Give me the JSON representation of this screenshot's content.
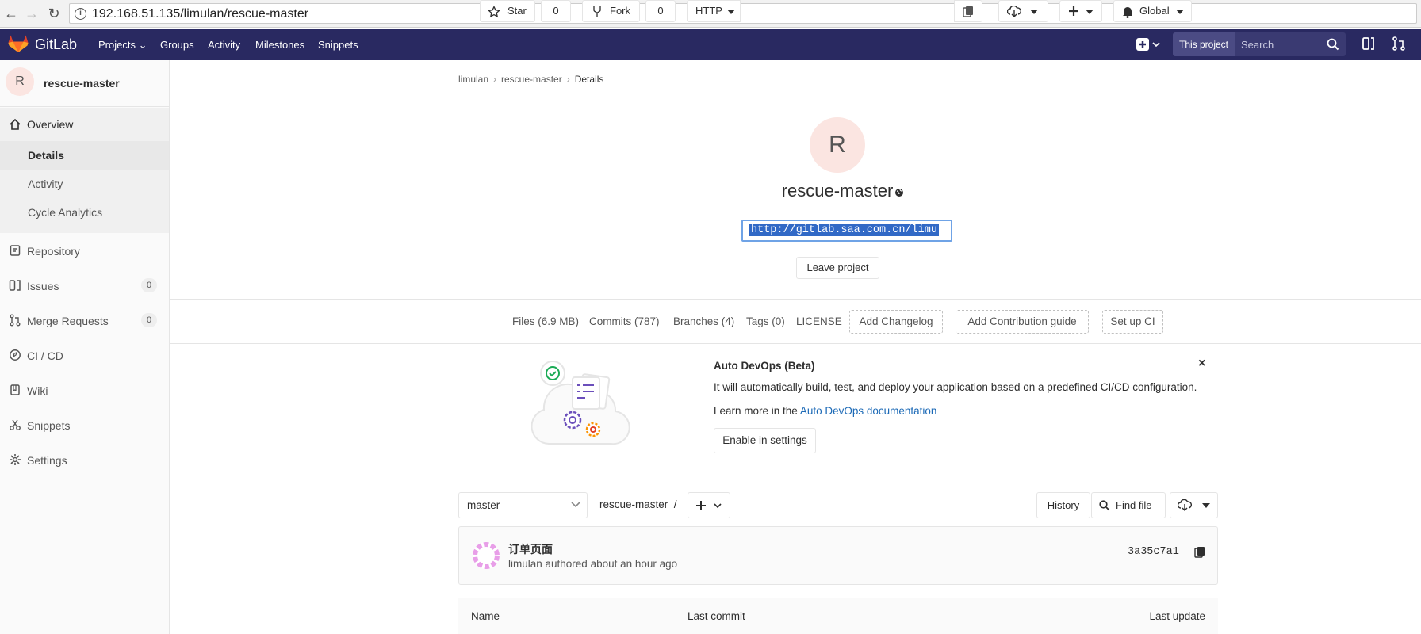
{
  "browser": {
    "url": "192.168.51.135/limulan/rescue-master"
  },
  "header": {
    "brand": "GitLab",
    "nav": [
      "Projects",
      "Groups",
      "Activity",
      "Milestones",
      "Snippets"
    ],
    "scope_label": "This project",
    "search_placeholder": "Search",
    "brand_color": "#292961"
  },
  "sidebar": {
    "project_initial": "R",
    "project_name": "rescue-master",
    "overview_label": "Overview",
    "overview_items": [
      "Details",
      "Activity",
      "Cycle Analytics"
    ],
    "items": [
      {
        "label": "Repository",
        "icon": "repository-icon"
      },
      {
        "label": "Issues",
        "count": "0",
        "icon": "issues-icon"
      },
      {
        "label": "Merge Requests",
        "count": "0",
        "icon": "merge-request-icon"
      },
      {
        "label": "CI / CD",
        "icon": "rocket-icon"
      },
      {
        "label": "Wiki",
        "icon": "book-icon"
      },
      {
        "label": "Snippets",
        "icon": "scissors-icon"
      },
      {
        "label": "Settings",
        "icon": "gear-icon"
      }
    ]
  },
  "breadcrumb": [
    "limulan",
    "rescue-master",
    "Details"
  ],
  "project": {
    "initial": "R",
    "name": "rescue-master",
    "star_label": "Star",
    "star_count": "0",
    "fork_label": "Fork",
    "fork_count": "0",
    "protocol": "HTTP",
    "clone_url": "http://gitlab.saa.com.cn/limu",
    "notification_label": "Global",
    "leave_label": "Leave project"
  },
  "stats": {
    "files": "Files (6.9 MB)",
    "commits": "Commits (787)",
    "branches": "Branches (4)",
    "tags": "Tags (0)",
    "license": "LICENSE",
    "add_changelog": "Add Changelog",
    "add_contribution": "Add Contribution guide",
    "setup_ci": "Set up CI"
  },
  "devops": {
    "title": "Auto DevOps (Beta)",
    "text": "It will automatically build, test, and deploy your application based on a predefined CI/CD configuration.",
    "more_prefix": "Learn more in the ",
    "more_link": "Auto DevOps documentation",
    "enable_label": "Enable in settings",
    "close_symbol": "×"
  },
  "tree": {
    "branch": "master",
    "path": "rescue-master",
    "path_sep": "/",
    "history_label": "History",
    "find_file_label": "Find file"
  },
  "commit": {
    "message": "订单页面",
    "author_line": "limulan authored about an hour ago",
    "sha": "3a35c7a1"
  },
  "table": {
    "headers": [
      "Name",
      "Last commit",
      "Last update"
    ]
  }
}
